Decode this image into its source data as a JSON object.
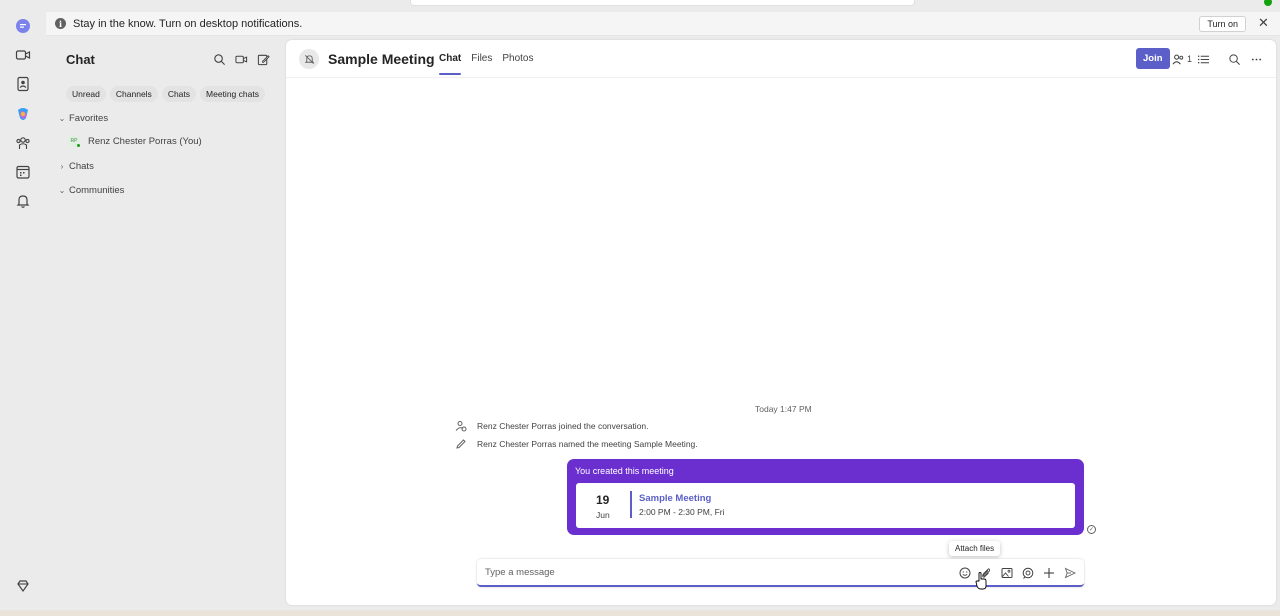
{
  "notification": {
    "text": "Stay in the know. Turn on desktop notifications.",
    "turn_on_label": "Turn on",
    "icon": "info-icon"
  },
  "rail": {
    "items": [
      "chat-icon",
      "video-icon",
      "contacts-icon",
      "copilot-icon",
      "teams-icon",
      "calendar-icon",
      "bell-icon",
      "premium-icon"
    ]
  },
  "chat_list": {
    "title": "Chat",
    "filters": [
      "Unread",
      "Channels",
      "Chats",
      "Meeting chats"
    ],
    "sections": {
      "favorites": "Favorites",
      "chats": "Chats",
      "communities": "Communities"
    },
    "favorite_items": [
      {
        "name": "Renz Chester Porras (You)",
        "initials": "RP"
      }
    ]
  },
  "meeting": {
    "title": "Sample Meeting",
    "tabs": [
      "Chat",
      "Files",
      "Photos"
    ],
    "active_tab": "Chat",
    "join_label": "Join",
    "participant_count": "1"
  },
  "messages": {
    "timestamp": "Today 1:47 PM",
    "system": [
      "Renz Chester Porras joined the conversation.",
      "Renz Chester Porras named the meeting Sample Meeting."
    ],
    "card": {
      "header": "You created this meeting",
      "day": "19",
      "month": "Jun",
      "event_title": "Sample Meeting",
      "event_time": "2:00 PM - 2:30 PM, Fri"
    }
  },
  "tooltip": "Attach files",
  "compose": {
    "placeholder": "Type a message"
  },
  "colors": {
    "accent": "#5b5fc7",
    "card": "#6b2fd0",
    "presence": "#13a10e"
  }
}
